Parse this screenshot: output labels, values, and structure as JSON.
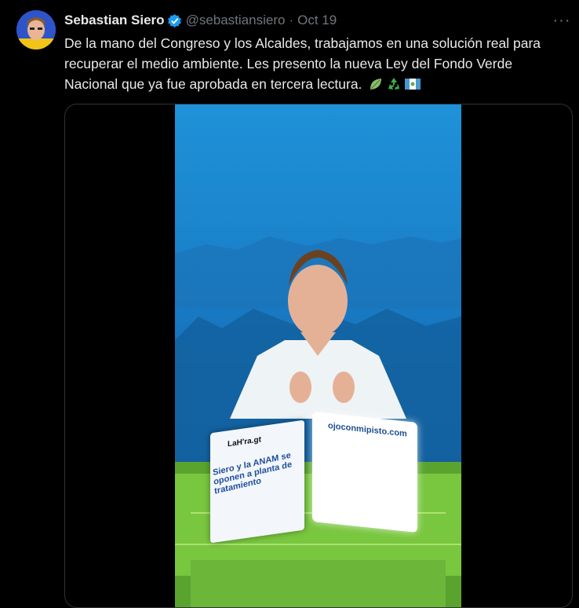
{
  "tweet": {
    "author_name": "Sebastian Siero",
    "handle": "@sebastiansiero",
    "separator": "·",
    "date": "Oct 19",
    "more_icon": "···",
    "text": "De la mano del Congreso y los Alcaldes, trabajamos en una solución real para recuperar el medio ambiente. Les presento la nueva Ley del Fondo Verde Nacional que ya fue aprobada en tercera lectura.",
    "emojis": [
      "leaf-icon",
      "recycle-icon",
      "guatemala-flag-icon"
    ]
  },
  "video": {
    "left_card_brand": "LaH'ra.gt",
    "left_card_headline": "Siero y la ANAM se oponen a planta de tratamiento",
    "right_card_brand": "ojoconmipisto.com"
  },
  "colors": {
    "verified": "#1d9bf0",
    "muted": "#71767b",
    "text": "#e7e9ea"
  }
}
